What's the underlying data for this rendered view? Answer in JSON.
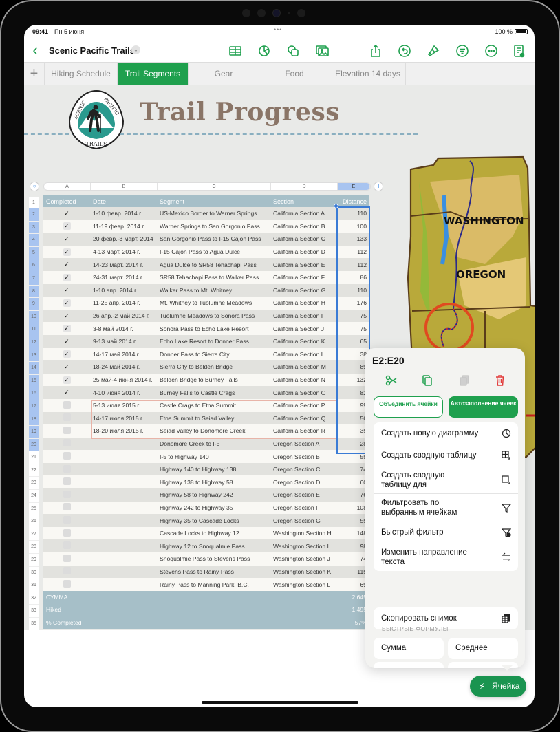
{
  "status_bar": {
    "time": "09:41",
    "date": "Пн 5 июня",
    "dots": "•••",
    "battery": "100 %"
  },
  "toolbar": {
    "document_title": "Scenic Pacific Trails",
    "icons": [
      "table-icon",
      "chart-icon",
      "shapes-icon",
      "media-icon",
      "share-icon",
      "undo-icon",
      "format-brush-icon",
      "organize-icon",
      "more-icon",
      "reading-view-icon"
    ],
    "accent_color": "#1fa04e"
  },
  "tabs": {
    "add": "+",
    "items": [
      {
        "label": "Hiking Schedule",
        "active": false
      },
      {
        "label": "Trail Segments",
        "active": true
      },
      {
        "label": "Gear",
        "active": false
      },
      {
        "label": "Food",
        "active": false
      },
      {
        "label": "Elevation 14 days",
        "active": false
      }
    ]
  },
  "sheet": {
    "title": "Trail Progress",
    "logo": {
      "top": "SCENIC",
      "right": "PACIFIC",
      "bottom": "TRAILS"
    },
    "map_labels": [
      "WASHINGTON",
      "OREGON"
    ]
  },
  "table": {
    "column_letters": [
      "A",
      "B",
      "C",
      "D",
      "E"
    ],
    "selected_column": "E",
    "headers": [
      "Completed",
      "Date",
      "Segment",
      "Section",
      "Distance"
    ],
    "row_numbers": [
      "1",
      "2",
      "3",
      "4",
      "5",
      "6",
      "7",
      "8",
      "9",
      "10",
      "11",
      "12",
      "13",
      "14",
      "15",
      "16",
      "17",
      "18",
      "19",
      "20",
      "21",
      "22",
      "23",
      "24",
      "25",
      "26",
      "27",
      "28",
      "29",
      "30",
      "31",
      "32",
      "33",
      "35"
    ],
    "rows": [
      {
        "done": true,
        "date": "1-10 февр. 2014 г.",
        "segment": "US-Mexico Border to Warner Springs",
        "section": "California Section A",
        "distance": "110"
      },
      {
        "done": true,
        "date": "11-19 февр. 2014 г.",
        "segment": "Warner Springs to San Gorgonio Pass",
        "section": "California Section B",
        "distance": "100"
      },
      {
        "done": true,
        "date": "20 февр.-3 март. 2014",
        "segment": "San Gorgonio Pass to I-15 Cajon Pass",
        "section": "California Section C",
        "distance": "133"
      },
      {
        "done": true,
        "date": "4-13 март. 2014 г.",
        "segment": "I-15 Cajon Pass to Agua Dulce",
        "section": "California Section D",
        "distance": "112"
      },
      {
        "done": true,
        "date": "14-23 март. 2014 г.",
        "segment": "Agua Dulce to SR58 Tehachapi Pass",
        "section": "California Section E",
        "distance": "112"
      },
      {
        "done": true,
        "date": "24-31 март. 2014 г.",
        "segment": "SR58 Tehachapi Pass to Walker Pass",
        "section": "California Section F",
        "distance": "86"
      },
      {
        "done": true,
        "date": "1-10 апр. 2014 г.",
        "segment": "Walker Pass to Mt. Whitney",
        "section": "California Section G",
        "distance": "110"
      },
      {
        "done": true,
        "date": "11-25 апр. 2014 г.",
        "segment": "Mt. Whitney to Tuolumne Meadows",
        "section": "California Section H",
        "distance": "176"
      },
      {
        "done": true,
        "date": "26 апр.-2 май 2014 г.",
        "segment": "Tuolumne Meadows to Sonora Pass",
        "section": "California Section I",
        "distance": "75"
      },
      {
        "done": true,
        "date": "3-8 май 2014 г.",
        "segment": "Sonora Pass to Echo Lake Resort",
        "section": "California Section J",
        "distance": "75"
      },
      {
        "done": true,
        "date": "9-13 май 2014 г.",
        "segment": "Echo Lake Resort to Donner Pass",
        "section": "California Section K",
        "distance": "65"
      },
      {
        "done": true,
        "date": "14-17 май 2014 г.",
        "segment": "Donner Pass to Sierra City",
        "section": "California Section L",
        "distance": "38"
      },
      {
        "done": true,
        "date": "18-24 май 2014 г.",
        "segment": "Sierra City to Belden Bridge",
        "section": "California Section M",
        "distance": "89"
      },
      {
        "done": true,
        "date": "25 май-4 июня 2014 г.",
        "segment": "Belden Bridge to Burney Falls",
        "section": "California Section N",
        "distance": "132"
      },
      {
        "done": true,
        "date": "4-10 июня 2014 г.",
        "segment": "Burney Falls to Castle Crags",
        "section": "California Section O",
        "distance": "82"
      },
      {
        "done": false,
        "date": "5-13 июля 2015 г.",
        "segment": "Castle Crags to Etna Summit",
        "section": "California Section P",
        "distance": "99"
      },
      {
        "done": false,
        "date": "14-17 июля 2015 г.",
        "segment": "Etna Summit to Seiad Valley",
        "section": "California Section Q",
        "distance": "56"
      },
      {
        "done": false,
        "date": "18-20 июля 2015 г.",
        "segment": "Seiad Valley to Donomore Creek",
        "section": "California Section R",
        "distance": "35"
      },
      {
        "done": false,
        "date": "",
        "segment": "Donomore Creek to I-5",
        "section": "Oregon Section A",
        "distance": "28"
      },
      {
        "done": false,
        "date": "",
        "segment": "I-5 to Highway 140",
        "section": "Oregon Section B",
        "distance": "55"
      },
      {
        "done": false,
        "date": "",
        "segment": "Highway 140 to Highway 138",
        "section": "Oregon Section C",
        "distance": "74"
      },
      {
        "done": false,
        "date": "",
        "segment": "Highway 138 to Highway 58",
        "section": "Oregon Section D",
        "distance": "60"
      },
      {
        "done": false,
        "date": "",
        "segment": "Highway 58 to Highway 242",
        "section": "Oregon Section E",
        "distance": "76"
      },
      {
        "done": false,
        "date": "",
        "segment": "Highway 242 to Highway 35",
        "section": "Oregon Section F",
        "distance": "108"
      },
      {
        "done": false,
        "date": "",
        "segment": "Highway 35 to Cascade Locks",
        "section": "Oregon Section G",
        "distance": "55"
      },
      {
        "done": false,
        "date": "",
        "segment": "Cascade Locks to Highway 12",
        "section": "Washington Section H",
        "distance": "148"
      },
      {
        "done": false,
        "date": "",
        "segment": "Highway 12 to Snoqualmie Pass",
        "section": "Washington Section I",
        "distance": "98"
      },
      {
        "done": false,
        "date": "",
        "segment": "Snoqualmie Pass to Stevens Pass",
        "section": "Washington Section J",
        "distance": "74"
      },
      {
        "done": false,
        "date": "",
        "segment": "Stevens Pass to Rainy Pass",
        "section": "Washington Section K",
        "distance": "115"
      },
      {
        "done": false,
        "date": "",
        "segment": "Rainy Pass to Manning Park, B.C.",
        "section": "Washington Section L",
        "distance": "69"
      }
    ],
    "footer": [
      {
        "label": "СУММА",
        "value": "2 645"
      },
      {
        "label": "Hiked",
        "value": "1 495"
      },
      {
        "label": "% Completed",
        "value": "57%"
      }
    ],
    "colors": {
      "header": "#a6bfc8",
      "row_alt": "#e2e2de",
      "row": "#f9f8f4",
      "selection": "#3a7bd5"
    }
  },
  "popover": {
    "range": "E2:E20",
    "actions": [
      "cut-icon",
      "copy-icon",
      "paste-icon",
      "delete-icon"
    ],
    "merge_button": "Объединить ячейки",
    "autofill_button": "Автозаполнение ячеек",
    "menu": [
      {
        "label": "Создать новую диаграмму",
        "icon": "chart-icon"
      },
      {
        "label": "Создать сводную таблицу",
        "icon": "pivot-table-icon"
      },
      {
        "label": "Создать сводную таблицу для",
        "icon": "pivot-for-icon"
      },
      {
        "label": "Фильтровать по выбранным ячейкам",
        "icon": "filter-icon"
      },
      {
        "label": "Быстрый фильтр",
        "icon": "quick-filter-icon"
      },
      {
        "label": "Изменить направление текста",
        "icon": "text-direction-icon"
      }
    ],
    "snapshot": {
      "label": "Скопировать снимок",
      "icon": "snapshot-icon"
    },
    "quick_formulas_label": "БЫСТРЫЕ ФОРМУЛЫ",
    "formulas": [
      "Сумма",
      "Среднее"
    ]
  },
  "cell_button": {
    "label": "Ячейка",
    "icon": "bolt-icon"
  }
}
